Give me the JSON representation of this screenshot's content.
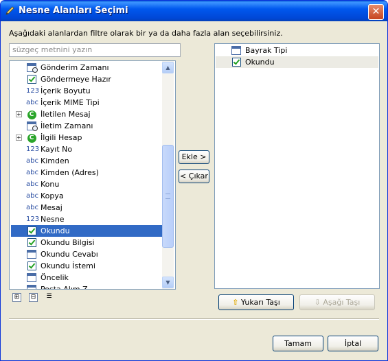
{
  "window": {
    "title": "Nesne Alanları Seçimi",
    "close_label": "✕"
  },
  "instructions": "Aşağıdaki alanlardan filtre olarak bir ya da daha fazla alan seçebilirsiniz.",
  "filter": {
    "placeholder": "süzgeç metnini yazın",
    "value": ""
  },
  "available_fields": [
    {
      "label": "Gönderim Zamanı",
      "icon": "calendar-clock-icon",
      "expander": false,
      "selected": false
    },
    {
      "label": "Göndermeye Hazır",
      "icon": "checkbox-icon",
      "expander": false,
      "selected": false
    },
    {
      "label": "İçerik Boyutu",
      "icon": "number-icon",
      "icon_text": "123",
      "expander": false,
      "selected": false
    },
    {
      "label": "İçerik MIME Tipi",
      "icon": "text-icon",
      "icon_text": "abc",
      "expander": false,
      "selected": false
    },
    {
      "label": "İletilen Mesaj",
      "icon": "object-icon",
      "icon_text": "C",
      "expander": true,
      "selected": false
    },
    {
      "label": "İletim Zamanı",
      "icon": "calendar-clock-icon",
      "expander": false,
      "selected": false
    },
    {
      "label": "İlgili Hesap",
      "icon": "object-icon",
      "icon_text": "C",
      "expander": true,
      "selected": false
    },
    {
      "label": "Kayıt No",
      "icon": "number-icon",
      "icon_text": "123",
      "expander": false,
      "selected": false
    },
    {
      "label": "Kimden",
      "icon": "text-icon",
      "icon_text": "abc",
      "expander": false,
      "selected": false
    },
    {
      "label": "Kimden (Adres)",
      "icon": "text-icon",
      "icon_text": "abc",
      "expander": false,
      "selected": false
    },
    {
      "label": "Konu",
      "icon": "text-icon",
      "icon_text": "abc",
      "expander": false,
      "selected": false
    },
    {
      "label": "Kopya",
      "icon": "text-icon",
      "icon_text": "abc",
      "expander": false,
      "selected": false
    },
    {
      "label": "Mesaj",
      "icon": "text-icon",
      "icon_text": "abc",
      "expander": false,
      "selected": false
    },
    {
      "label": "Nesne",
      "icon": "number-icon",
      "icon_text": "123",
      "expander": false,
      "selected": false
    },
    {
      "label": "Okundu",
      "icon": "checkbox-icon",
      "expander": false,
      "selected": true
    },
    {
      "label": "Okundu Bilgisi",
      "icon": "checkbox-icon",
      "expander": false,
      "selected": false
    },
    {
      "label": "Okundu Cevabı",
      "icon": "calendar-icon",
      "expander": false,
      "selected": false
    },
    {
      "label": "Okundu İstemi",
      "icon": "checkbox-icon",
      "expander": false,
      "selected": false
    },
    {
      "label": "Öncelik",
      "icon": "calendar-icon",
      "expander": false,
      "selected": false
    },
    {
      "label": "Posta Alım Z...",
      "icon": "calendar-clock-icon",
      "expander": false,
      "selected": false
    }
  ],
  "tree_buttons": {
    "expand_all": "⊞",
    "collapse_all": "⊟",
    "list_view": "☰"
  },
  "buttons": {
    "add": "Ekle >",
    "remove": "< Çıkar",
    "move_up": "Yukarı Taşı",
    "move_down": "Aşağı Taşı",
    "ok": "Tamam",
    "cancel": "İptal"
  },
  "selected_fields": [
    {
      "label": "Bayrak Tipi",
      "icon": "calendar-icon",
      "highlighted": false
    },
    {
      "label": "Okundu",
      "icon": "checkbox-icon",
      "highlighted": true
    }
  ],
  "colors": {
    "title_bar": "#0058ee",
    "selection": "#316ac5",
    "check_green": "#21a121"
  }
}
